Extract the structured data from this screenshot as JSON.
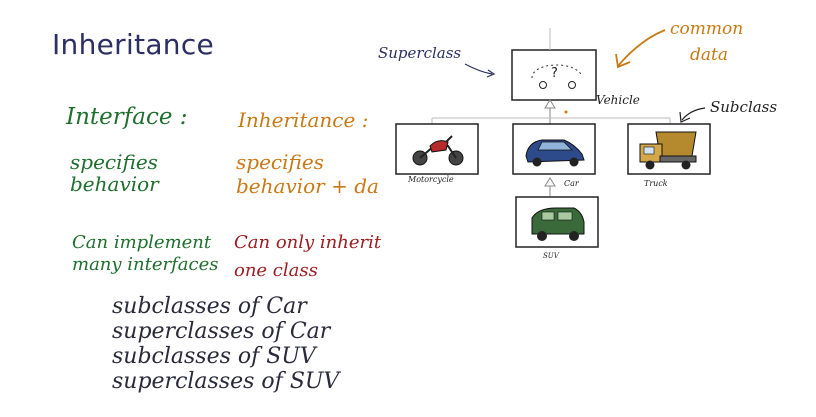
{
  "title": "Inheritance",
  "left": {
    "interface_heading": "Interface :",
    "inheritance_heading": "Inheritance :",
    "interface_specifies_1": "specifies",
    "interface_specifies_2": "behavior",
    "inheritance_specifies_1": "specifies",
    "inheritance_specifies_2": "behavior + da",
    "interface_can_1": "Can implement",
    "interface_can_2": "many interfaces",
    "inheritance_can_1": "Can only inherit",
    "inheritance_can_2": "one class",
    "questions": [
      "subclasses of Car",
      "superclasses of Car",
      "subclasses of SUV",
      "superclasses of SUV"
    ]
  },
  "diagram": {
    "superclass_label": "Superclass",
    "common_data_1": "common",
    "common_data_2": "data",
    "subclass_label": "Subclass",
    "vehicle_label": "Vehicle",
    "vehicle_mark": "?",
    "motorcycle_label": "Motorcycle",
    "car_label": "Car",
    "truck_label": "Truck",
    "suv_label": "SUV"
  },
  "colors": {
    "green": "#1f6f2f",
    "orange": "#c97a14",
    "red": "#9c1e22",
    "title": "#2b2f63"
  }
}
